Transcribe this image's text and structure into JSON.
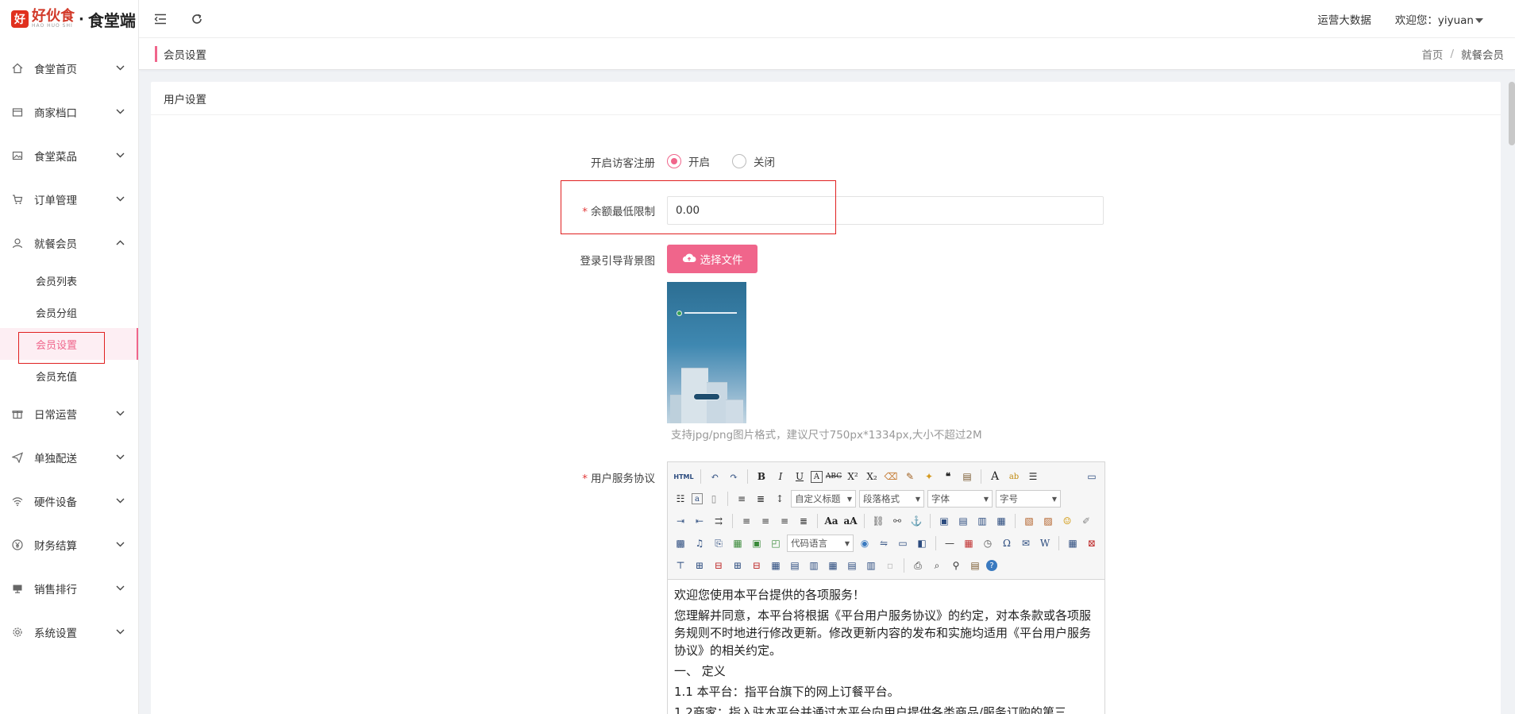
{
  "logo": {
    "mark": "好",
    "brand": "好伙食",
    "brand_small": "HAO HUO SHI",
    "separator": "·",
    "name": "食堂端"
  },
  "sidebar": {
    "items": [
      {
        "label": "食堂首页",
        "icon": "home-icon"
      },
      {
        "label": "商家档口",
        "icon": "shop-icon"
      },
      {
        "label": "食堂菜品",
        "icon": "image-icon"
      },
      {
        "label": "订单管理",
        "icon": "cart-icon"
      },
      {
        "label": "就餐会员",
        "icon": "user-icon",
        "expanded": true
      },
      {
        "label": "日常运营",
        "icon": "gift-icon"
      },
      {
        "label": "单独配送",
        "icon": "send-icon"
      },
      {
        "label": "硬件设备",
        "icon": "wifi-icon"
      },
      {
        "label": "财务结算",
        "icon": "yuan-icon"
      },
      {
        "label": "销售排行",
        "icon": "monitor-icon"
      },
      {
        "label": "系统设置",
        "icon": "gear-icon"
      }
    ],
    "submenu": [
      {
        "label": "会员列表"
      },
      {
        "label": "会员分组"
      },
      {
        "label": "会员设置",
        "active": true
      },
      {
        "label": "会员充值"
      }
    ]
  },
  "header": {
    "big_data": "运营大数据",
    "welcome": "欢迎您：yiyuan"
  },
  "tagbar": {
    "title": "会员设置",
    "breadcrumb_home": "首页",
    "breadcrumb_sep": "/",
    "breadcrumb_current": "就餐会员"
  },
  "card": {
    "title": "用户设置"
  },
  "form": {
    "guest_label": "开启访客注册",
    "opt_on": "开启",
    "opt_off": "关闭",
    "balance_label": "余额最低限制",
    "balance_value": "0.00",
    "bg_label": "登录引导背景图",
    "upload_label": "选择文件",
    "hint": "支持jpg/png图片格式，建议尺寸750px*1334px,大小不超过2M",
    "agreement_label": "用户服务协议"
  },
  "editor": {
    "html_btn": "HTML",
    "sel_custom_title": "自定义标题",
    "sel_paragraph": "段落格式",
    "sel_font": "字体",
    "sel_size": "字号",
    "sel_code": "代码语言",
    "content": [
      "欢迎您使用本平台提供的各项服务！",
      "您理解并同意，本平台将根据《平台用户服务协议》的约定，对本条款或各项服务规则不时地进行修改更新。修改更新内容的发布和实施均适用《平台用户服务协议》的相关约定。",
      "一、 定义",
      "1.1 本平台：指平台旗下的网上订餐平台。",
      "1.2商家：指入驻本平台并通过本平台向用户提供各类商品/服务订购的第三"
    ]
  },
  "colors": {
    "accent": "#f0658b",
    "highlight": "#e02020"
  }
}
